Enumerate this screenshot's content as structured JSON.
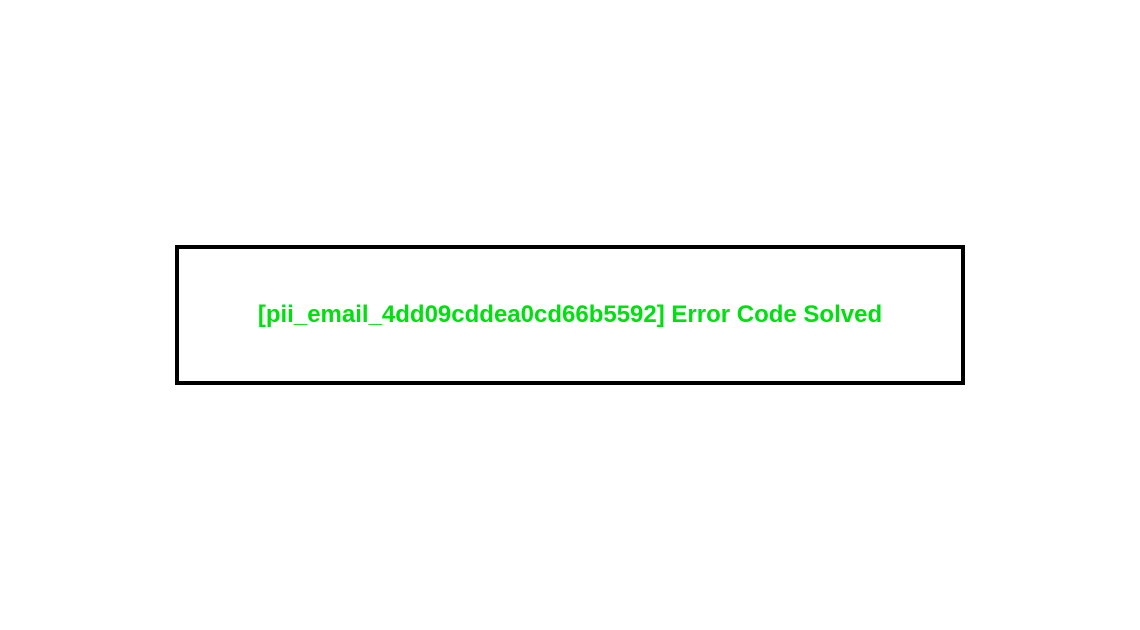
{
  "banner": {
    "title": "[pii_email_4dd09cddea0cd66b5592] Error Code Solved"
  }
}
